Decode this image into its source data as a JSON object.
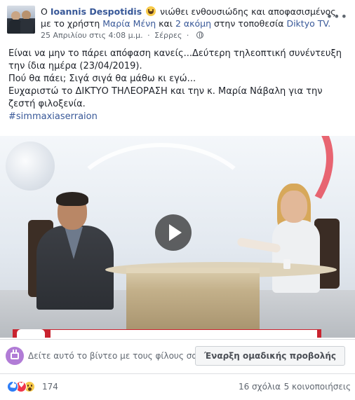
{
  "header": {
    "prefix": "Ο",
    "author_name": "Ioannis Despotidis",
    "feeling_text": "νιώθει ενθουσιώδης και αποφασισμένος",
    "with_text": "με το χρήστη",
    "tagged_user": "Μαρία Μένη",
    "and_text": "και",
    "others_link": "2 ακόμη",
    "location_text": "στην τοποθεσία",
    "location_link": "Diktyo TV.",
    "date": "25 Απριλίου στις 4:08 μ.μ.",
    "place": "Σέρρες",
    "more_icon": "more-options-icon"
  },
  "post": {
    "line1": "Είναι να μην το πάρει απόφαση κανείς...Δεύτερη τηλεοπτική συνέντευξη την ίδια ημέρα (23/04/2019).",
    "line2": "Πού θα πάει; Σιγά σιγά θα μάθω κι εγώ...",
    "line3": "Ευχαριστώ το ΔΙΚΤΥΟ ΤΗΛΕΟΡΑΣΗ και την κ. Μαρία Νάβαλη για την ζεστή φιλοξενία.",
    "hashtag": "#simmaxiaserraion"
  },
  "video": {
    "play_icon": "play-icon"
  },
  "watch_party": {
    "text": "Δείτε αυτό το βίντεο με τους φίλους σας",
    "button_label": "Έναρξη ομαδικής προβολής"
  },
  "reactions": {
    "count": "174",
    "comments": "16 σχόλια",
    "shares": "5 κοινοποιήσεις",
    "colors": {
      "like": "#2d7df6",
      "love": "#f0364c",
      "wow": "#f7c948"
    }
  }
}
